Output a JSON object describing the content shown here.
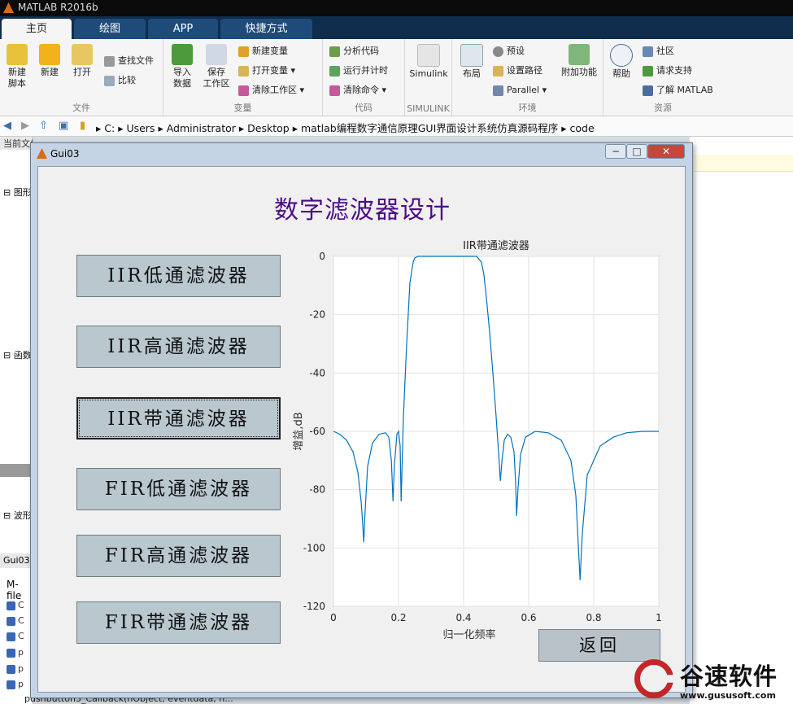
{
  "app": {
    "title": "MATLAB R2016b"
  },
  "tabs": [
    "主页",
    "绘图",
    "APP",
    "快捷方式"
  ],
  "ribbon": {
    "file": {
      "label": "文件",
      "new_script": "新建\n脚本",
      "new": "新建",
      "open": "打开",
      "find_files": "查找文件",
      "compare": "比较"
    },
    "variable": {
      "label": "变量",
      "import_data": "导入\n数据",
      "save_workspace": "保存\n工作区",
      "new_variable": "新建变量",
      "open_variable": "打开变量",
      "clear_workspace": "清除工作区"
    },
    "code": {
      "label": "代码",
      "analyze": "分析代码",
      "run_time": "运行并计时",
      "clear_commands": "清除命令"
    },
    "simulink": {
      "label": "SIMULINK",
      "simulink": "Simulink"
    },
    "environment": {
      "label": "环境",
      "layout": "布局",
      "preferences": "预设",
      "set_path": "设置路径",
      "parallel": "Parallel",
      "addons": "附加功能"
    },
    "resources": {
      "label": "资源",
      "help": "帮助",
      "community": "社区",
      "request_support": "请求支持",
      "learn_matlab": "了解 MATLAB"
    }
  },
  "address": {
    "path": [
      "C:",
      "Users",
      "Administrator",
      "Desktop",
      "matlab编程数字通信原理GUI界面设计系统仿真源码程序",
      "code"
    ]
  },
  "left_panel": {
    "header": "当前文件夹",
    "sections": [
      "图形",
      "函数",
      "波形"
    ],
    "footer_label": "Gui03",
    "mfile_label": "M-file",
    "items": [
      "C",
      "C",
      "C",
      "p",
      "p",
      "p"
    ]
  },
  "bottom_text": "pushbutton5_Callback(hObject, eventdata, h...",
  "window": {
    "title": "Gui03"
  },
  "app_ui": {
    "heading": "数字滤波器设计",
    "buttons": [
      "IIR低通滤波器",
      "IIR高通滤波器",
      "IIR带通滤波器",
      "FIR低通滤波器",
      "FIR高通滤波器",
      "FIR带通滤波器"
    ],
    "back_button": "返回"
  },
  "chart_data": {
    "type": "line",
    "title": "IIR带通滤波器",
    "xlabel": "归一化频率",
    "ylabel": "增益,dB",
    "xlim": [
      0,
      1
    ],
    "ylim": [
      -120,
      0
    ],
    "xticks": [
      "0",
      "0.2",
      "0.4",
      "0.6",
      "0.8",
      "1"
    ],
    "yticks": [
      "0",
      "-20",
      "-40",
      "-60",
      "-80",
      "-100",
      "-120"
    ],
    "grid": true,
    "color": "#0072bd",
    "series": [
      {
        "x": [
          0,
          0.02,
          0.04,
          0.06,
          0.075,
          0.085,
          0.09,
          0.093,
          0.097,
          0.105,
          0.12,
          0.14,
          0.16,
          0.17,
          0.178,
          0.183,
          0.187,
          0.195,
          0.2,
          0.205,
          0.208,
          0.215,
          0.225,
          0.235,
          0.245,
          0.25,
          0.26,
          0.3,
          0.35,
          0.4,
          0.44,
          0.455,
          0.462,
          0.47,
          0.48,
          0.49,
          0.5,
          0.508,
          0.513,
          0.518,
          0.525,
          0.535,
          0.545,
          0.555,
          0.56,
          0.563,
          0.567,
          0.575,
          0.59,
          0.62,
          0.66,
          0.7,
          0.73,
          0.745,
          0.753,
          0.758,
          0.765,
          0.78,
          0.82,
          0.86,
          0.9,
          0.95,
          1
        ],
        "y": [
          -60,
          -61,
          -63,
          -67,
          -74,
          -84,
          -92,
          -98,
          -88,
          -72,
          -64,
          -61,
          -60.5,
          -62,
          -70,
          -84,
          -72,
          -61,
          -60,
          -65,
          -84,
          -55,
          -30,
          -9,
          -2,
          -0.5,
          0,
          0,
          0,
          0,
          0,
          -2,
          -6,
          -14,
          -26,
          -40,
          -55,
          -68,
          -77,
          -70,
          -63,
          -61,
          -62,
          -67,
          -78,
          -89,
          -80,
          -68,
          -62,
          -60,
          -60.5,
          -63,
          -70,
          -82,
          -100,
          -111,
          -95,
          -75,
          -65,
          -62,
          -60.5,
          -60,
          -60
        ]
      }
    ]
  }
}
